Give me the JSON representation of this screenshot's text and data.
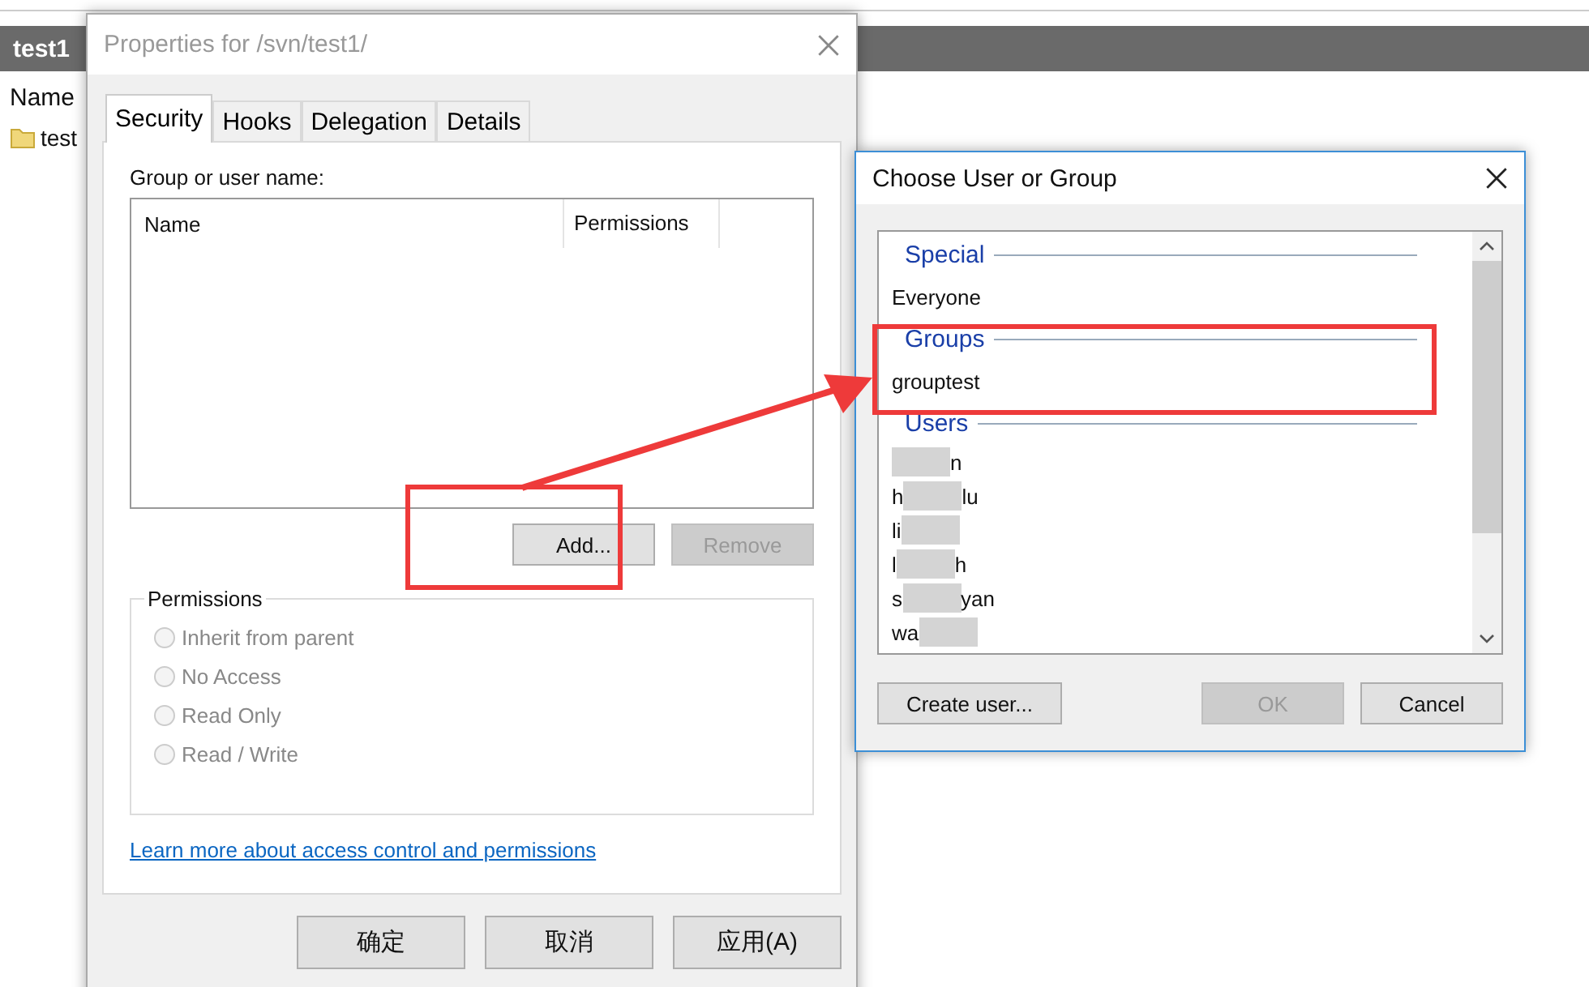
{
  "explorer": {
    "tab_title": "test1",
    "column_header": "Name",
    "items": [
      {
        "name": "test"
      }
    ]
  },
  "properties_dialog": {
    "title": "Properties for /svn/test1/",
    "tabs": [
      {
        "label": "Security",
        "selected": true
      },
      {
        "label": "Hooks",
        "selected": false
      },
      {
        "label": "Delegation",
        "selected": false
      },
      {
        "label": "Details",
        "selected": false
      }
    ],
    "group_label": "Group or user name:",
    "list_columns": [
      "Name",
      "Permissions"
    ],
    "add_button": {
      "label": "Add...",
      "disabled": false
    },
    "remove_button": {
      "label": "Remove",
      "disabled": true
    },
    "permissions": {
      "title": "Permissions",
      "options": [
        {
          "label": "Inherit from parent",
          "selected": false,
          "disabled": true
        },
        {
          "label": "No Access",
          "selected": false,
          "disabled": true
        },
        {
          "label": "Read Only",
          "selected": false,
          "disabled": true
        },
        {
          "label": "Read / Write",
          "selected": false,
          "disabled": true
        }
      ]
    },
    "link": "Learn more about access control and permissions",
    "buttons": [
      "确定",
      "取消",
      "应用(A)"
    ]
  },
  "choose_dialog": {
    "title": "Choose User or Group",
    "sections": [
      {
        "heading": "Special",
        "items": [
          {
            "kind": "name",
            "text": "Everyone"
          }
        ]
      },
      {
        "heading": "Groups",
        "items": [
          {
            "kind": "name",
            "text": "grouptest"
          }
        ]
      },
      {
        "heading": "Users",
        "items": [
          {
            "kind": "redacted",
            "after": "n"
          },
          {
            "kind": "redacted",
            "before": "h",
            "after": "lu"
          },
          {
            "kind": "redacted",
            "before": "li"
          },
          {
            "kind": "redacted",
            "before": "l",
            "after": "h"
          },
          {
            "kind": "redacted",
            "before": "s",
            "after": "yan"
          },
          {
            "kind": "redacted",
            "before": "wa"
          }
        ]
      }
    ],
    "buttons": [
      {
        "label": "Create user...",
        "disabled": false
      },
      {
        "label": "OK",
        "disabled": true
      },
      {
        "label": "Cancel",
        "disabled": false
      }
    ]
  }
}
